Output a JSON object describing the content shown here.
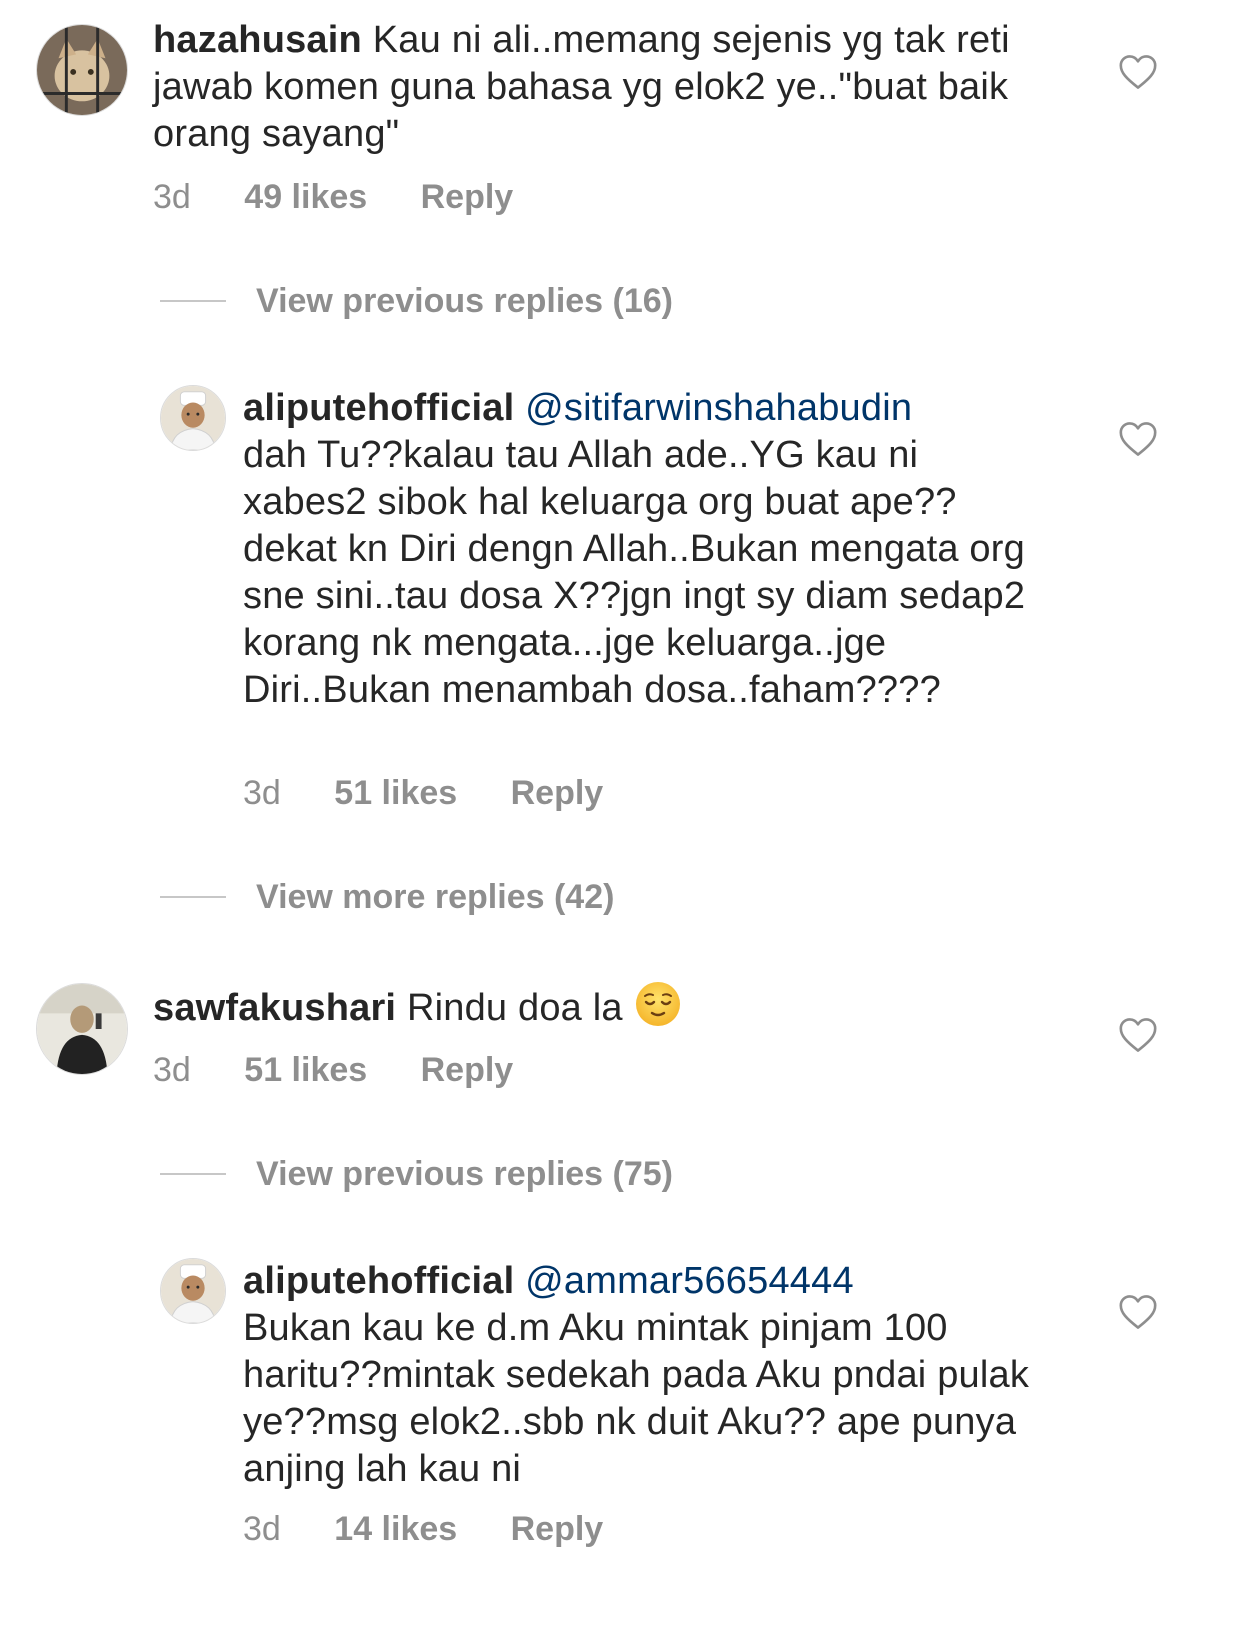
{
  "comments": [
    {
      "username": "hazahusain",
      "text": "Kau ni ali..memang sejenis yg tak reti jawab komen guna bahasa yg elok2 ye..\"buat baik orang sayang\"",
      "time": "3d",
      "likes": "49 likes",
      "reply": "Reply"
    },
    {
      "view_replies": "View previous replies (16)"
    },
    {
      "username": "alipute​hofficial",
      "mention": "@sitifarwinshahabudin",
      "text": "dah Tu??kalau tau Allah ade..YG kau ni xabes2 sibok hal keluarga org buat ape?? dekat kn Diri dengn Allah..Bukan mengata org sne sini..tau dosa X??jgn ingt sy diam sedap2 korang nk mengata...jge keluarga..jge Diri..Bukan menambah dosa..faham????",
      "time": "3d",
      "likes": "51 likes",
      "reply": "Reply"
    },
    {
      "view_replies": "View more replies (42)"
    },
    {
      "username": "sawfakushari",
      "text": "Rindu doa la",
      "emoji": "relieved-face-emoji",
      "time": "3d",
      "likes": "51 likes",
      "reply": "Reply"
    },
    {
      "view_replies": "View previous replies (75)"
    },
    {
      "username": "aliputehofficial",
      "mention": "@ammar56654444",
      "text": "Bukan kau ke d.m Aku mintak pinjam 100 haritu??mintak sedekah pada Aku pndai pulak ye??msg elok2..sbb nk duit Aku?? ape punya anjing lah kau ni",
      "time": "3d",
      "likes": "14 likes",
      "reply": "Reply"
    }
  ],
  "colors": {
    "text": "#262626",
    "meta": "#8e8e8e",
    "mention": "#003569",
    "divider": "#c7c7c7"
  },
  "icons": {
    "like": "heart-outline-icon"
  }
}
